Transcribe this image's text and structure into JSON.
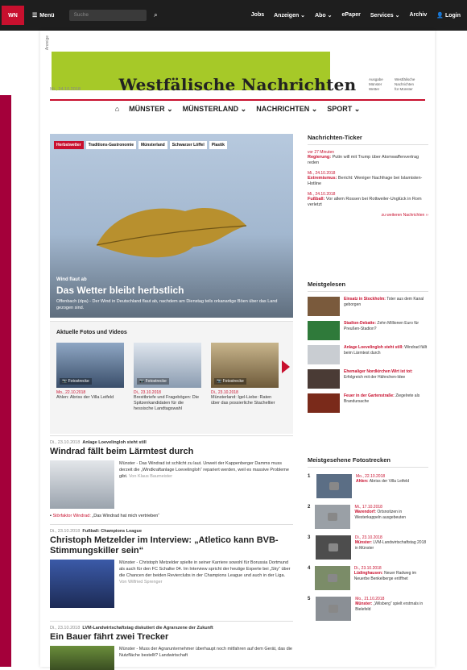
{
  "topbar": {
    "logo": "WN",
    "menu_label": "Menü",
    "search_placeholder": "Suche",
    "links": [
      "Jobs",
      "Anzeigen ⌄",
      "Abo ⌄",
      "ePaper",
      "Services ⌄",
      "Archiv"
    ],
    "login_label": "Login"
  },
  "ad": {
    "label": "Anzeige"
  },
  "masthead": {
    "date": "Mi., 24.10.2018",
    "title": "Westfälische Nachrichten",
    "left_small": [
      "Ausgabe",
      "Münster",
      "Wetter"
    ],
    "right_small": [
      "Westfälische",
      "Nachrichten",
      "für Münster"
    ]
  },
  "nav": {
    "items": [
      "MÜNSTER ⌄",
      "MÜNSTERLAND ⌄",
      "NACHRICHTEN ⌄",
      "SPORT ⌄"
    ]
  },
  "hero": {
    "tags": [
      "Herbstwetter",
      "Traditions-Gastronomie",
      "Münsterland",
      "Schwarzer Löffel",
      "Plastik"
    ],
    "kicker": "Wind flaut ab",
    "headline": "Das Wetter bleibt herbstlich",
    "teaser": "Offenbach (dpa) - Der Wind in Deutschland flaut ab, nachdem am Dienstag teils orkanartige Böen über das Land gezogen sind."
  },
  "photos": {
    "title": "Aktuelle Fotos und Videos",
    "items": [
      {
        "cap": "Fotostrecke",
        "date": "Mo., 22.10.2018",
        "text": "Ahlen: Abriss der Villa Leifeld"
      },
      {
        "cap": "Fotostrecke",
        "date": "Di., 23.10.2018",
        "text": "Brexitbriefe und Fragebögen: Die Spitzenkandidaten für die hessische Landtagswahl"
      },
      {
        "cap": "Fotostrecke",
        "date": "Di., 23.10.2018",
        "text": "Münsterland: Igel-Liebe: Raten über das possierliche Stacheltier"
      }
    ]
  },
  "articles": [
    {
      "date": "Di., 23.10.2018",
      "kicker": "Anlage Loevelingloh steht still",
      "headline": "Windrad fällt beim Lärmtest durch",
      "body": "Münster - Das Windrad ist schlicht zu laut. Unweit der Kappenberger Damms muss derzeit die „Windkraftanlage Loevelingloh“ repariert werden, weil es massive Probleme gibt.",
      "author": "Von Klaus Baumeister",
      "related_label": "Störfaktor Windrad:",
      "related_text": "„Das Windrad hat mich vertrieben“"
    },
    {
      "date": "Di., 23.10.2018",
      "kicker": "Fußball: Champions League",
      "headline": "Christoph Metzelder im Interview: „Atletico kann BVB-Stimmungskiller sein“",
      "body": "Münster - Christoph Metzelder spielte in seiner Karriere sowohl für Borussia Dortmund als auch für den FC Schalke 04. Im Interview spricht der heutige Experte bei „Sky“ über die Chancen der beiden Revierclubs in der Champions League und auch in der Liga.",
      "author": "Von Wilfried Sprenger"
    },
    {
      "date": "Di., 23.10.2018",
      "kicker": "LVM-Landwirtschaftstag diskutiert die Agrarszene der Zukunft",
      "headline": "Ein Bauer fährt zwei Trecker",
      "body": "Münster - Muss der Agrarunternehmer überhaupt noch mitfahren auf dem Gerät, das die Nutzfläche bestellt? Landwirtschaft",
      "author": ""
    }
  ],
  "ticker": {
    "title": "Nachrichten-Ticker",
    "items": [
      {
        "date": "vor 27 Minuten",
        "label": "Regierung:",
        "text": "Putin will mit Trump über Atomwaffenvertrag reden"
      },
      {
        "date": "Mi., 24.10.2018",
        "label": "Extremismus:",
        "text": "Bericht: Weniger Nachfrage bei Islamisten-Hotline"
      },
      {
        "date": "Mi., 24.10.2018",
        "label": "Fußball:",
        "text": "Vor allem Rossen bei Rottweiler-Unglück in Rom verletzt"
      }
    ],
    "more": "zu weiteren Nachrichten ››"
  },
  "most_read": {
    "title": "Meistgelesen",
    "items": [
      {
        "label": "Einsatz in Stockholm:",
        "text": "Toter aus dem Kanal geborgen"
      },
      {
        "label": "Stadion-Debatte:",
        "text": "Zehn Millionen Euro für Preußen-Stadion?"
      },
      {
        "label": "Anlage Loevelingloh steht still:",
        "text": "Windrad fällt beim Lärmtest durch"
      },
      {
        "label": "Ehemaliger Nordkirchen Wirt ist tot:",
        "text": "Erfolgreich mit der Hähnchen-Idee"
      },
      {
        "label": "Feuer in der Gartenstraße:",
        "text": "Ziegelrete als Brandursache"
      }
    ]
  },
  "fotostrecken": {
    "title": "Meistgesehene Fotostrecken",
    "items": [
      {
        "n": "1",
        "date": "Mo., 22.10.2018",
        "label": "Ahlen:",
        "text": "Abriss der Villa Leifeld"
      },
      {
        "n": "2",
        "date": "Mi., 17.10.2018",
        "label": "Warendorf:",
        "text": "Ortsnotizen in Westerkappeln ausgebeuten"
      },
      {
        "n": "3",
        "date": "Di., 23.10.2018",
        "label": "Münster:",
        "text": "LVM-Landwirtschaftstag 2018 in Münster"
      },
      {
        "n": "4",
        "date": "Di., 23.10.2018",
        "label": "Lüdinghausen:",
        "text": "Neuer Radweg im Neuerbe Benkelberge eröffnet"
      },
      {
        "n": "5",
        "date": "Mo., 21.10.2018",
        "label": "Münster:",
        "text": "„Wilsberg“ spielt erstmals in Bielefeld"
      }
    ]
  },
  "colors": {
    "brand": "#c8102e",
    "topbar": "#1e1e1e",
    "ad": "#a6c928",
    "side": "#a4003a"
  }
}
